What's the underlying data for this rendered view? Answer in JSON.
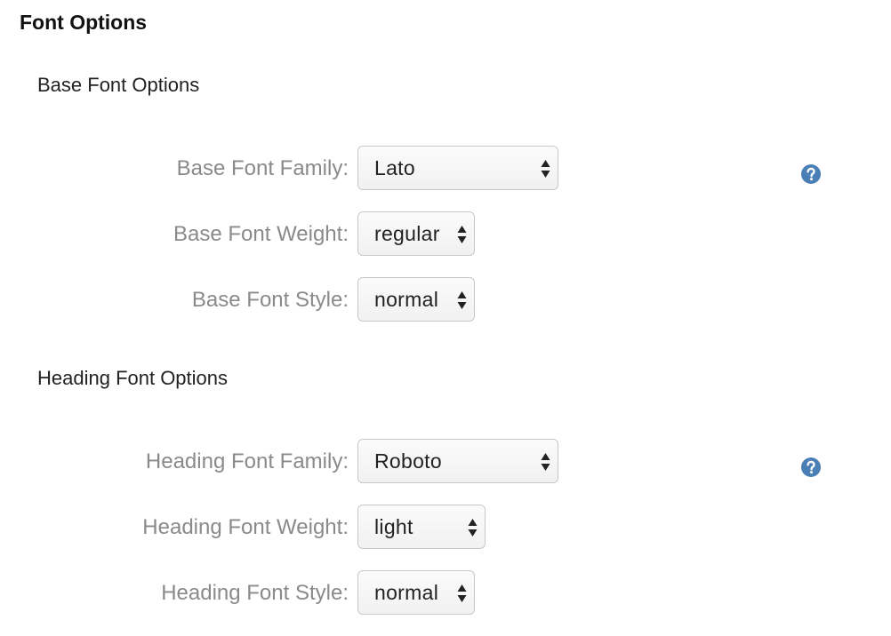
{
  "title": "Font Options",
  "base_section": {
    "title": "Base Font Options",
    "help_icon": "question-circle-icon",
    "fields": [
      {
        "label": "Base Font Family:",
        "value": "Lato"
      },
      {
        "label": "Base Font Weight:",
        "value": "regular"
      },
      {
        "label": "Base Font Style:",
        "value": "normal"
      }
    ]
  },
  "heading_section": {
    "title": "Heading Font Options",
    "help_icon": "question-circle-icon",
    "fields": [
      {
        "label": "Heading Font Family:",
        "value": "Roboto"
      },
      {
        "label": "Heading Font Weight:",
        "value": "light"
      },
      {
        "label": "Heading Font Style:",
        "value": "normal"
      }
    ]
  },
  "colors": {
    "label_text": "#8a8a8a",
    "help_icon": "#4a7fb5",
    "select_border": "#c8c8c8"
  }
}
